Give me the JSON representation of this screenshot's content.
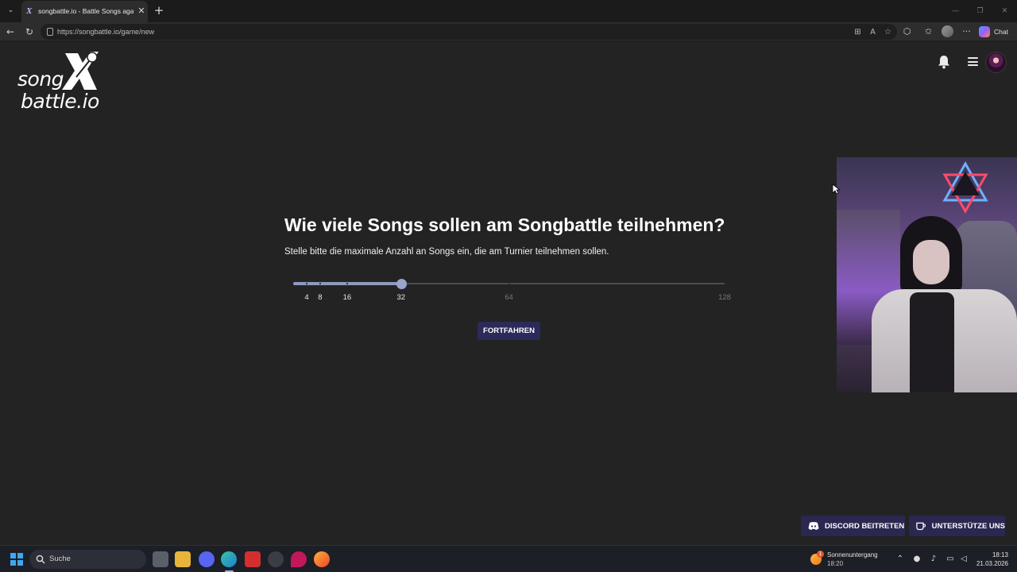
{
  "browser": {
    "tab_title": "songbattle.io - Battle Songs agai",
    "favicon_glyph": "X",
    "tab_close_glyph": "✕",
    "new_tab_glyph": "+",
    "url": "https://songbattle.io/game/new",
    "chat_label": "Chat",
    "more_glyph": "···"
  },
  "site": {
    "logo_top": "song",
    "logo_bottom": "battle.io"
  },
  "main": {
    "question": "Wie viele Songs sollen am Songbattle teilnehmen?",
    "subtitle": "Stelle bitte die maximale Anzahl an Songs ein, die am Turnier teilnehmen sollen.",
    "slider": {
      "options": [
        "4",
        "8",
        "16",
        "32",
        "64",
        "128"
      ],
      "selected_value": "32",
      "active_color": "#e8e8e8",
      "inactive_color": "#777777"
    },
    "continue_label": "FORTFAHREN"
  },
  "footer_buttons": {
    "discord_label": "DISCORD BEITRETEN",
    "support_label": "UNTERSTÜTZE UNS"
  },
  "taskbar": {
    "search_label": "Suche",
    "weather_title": "Sonnenuntergang",
    "weather_time": "18:20",
    "weather_badge": "1",
    "clock_time": "18:13",
    "clock_date": "21.03.2026"
  },
  "colors": {
    "page_bg": "#232323",
    "accent_button": "#2c2a5a",
    "slider_fill": "#8e9bbf"
  }
}
